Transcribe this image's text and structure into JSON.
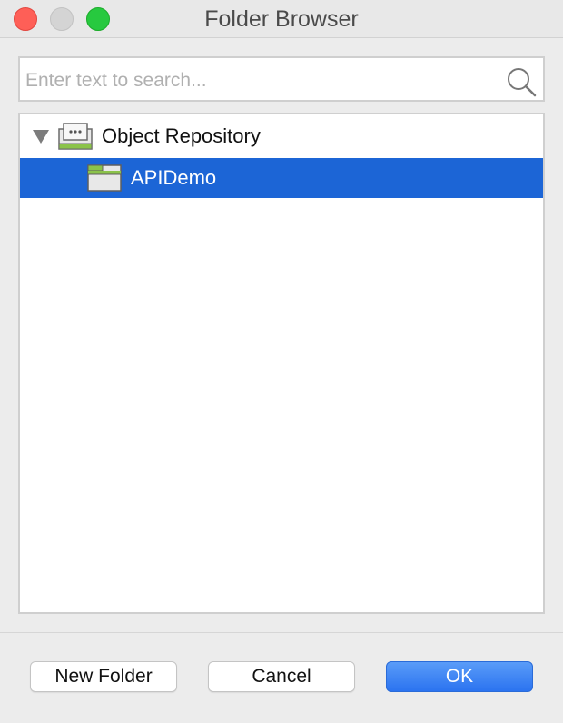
{
  "window": {
    "title": "Folder Browser"
  },
  "search": {
    "placeholder": "Enter text to search...",
    "value": "",
    "icon": "search-icon"
  },
  "tree": {
    "root": {
      "label": "Object Repository",
      "expanded": true,
      "icon": "repository-icon"
    },
    "children": [
      {
        "label": "APIDemo",
        "selected": true,
        "icon": "folder-icon"
      }
    ]
  },
  "buttons": {
    "new_folder": "New Folder",
    "cancel": "Cancel",
    "ok": "OK"
  },
  "colors": {
    "selection": "#1c65d6",
    "primary_button": "#2b73f0",
    "folder_tab": "#8bc34a"
  }
}
